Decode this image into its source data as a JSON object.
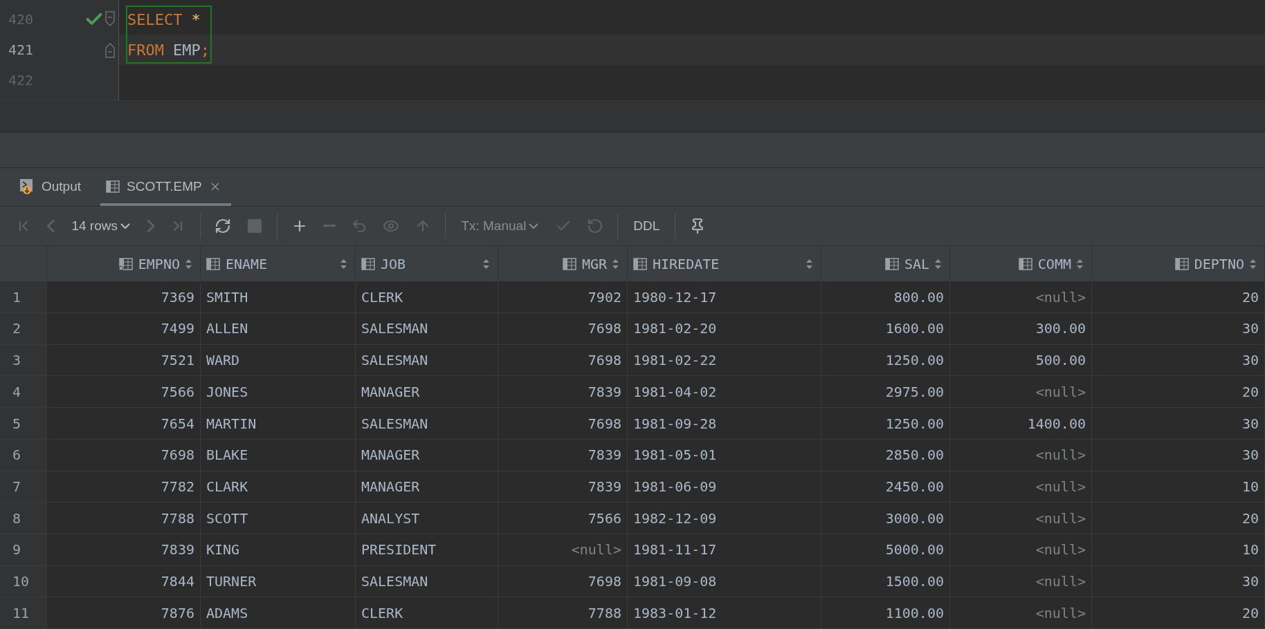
{
  "editor": {
    "lines": [
      {
        "number": "420",
        "current": false,
        "executed": true,
        "kind": "block-start",
        "tokens": [
          {
            "text": "SELECT",
            "kind": "keyword"
          },
          {
            "text": "*",
            "kind": "star"
          }
        ]
      },
      {
        "number": "421",
        "current": true,
        "executed": false,
        "kind": "block-end",
        "tokens": [
          {
            "text": "FROM",
            "kind": "keyword"
          },
          {
            "text": "EMP",
            "kind": "plain"
          },
          {
            "text": ";",
            "kind": "punct"
          }
        ]
      },
      {
        "number": "422",
        "current": false,
        "executed": false,
        "kind": "plain"
      }
    ]
  },
  "tabs": [
    {
      "label": "Output",
      "kind": "output",
      "selected": false,
      "closable": false
    },
    {
      "label": "SCOTT.EMP",
      "kind": "table",
      "selected": true,
      "closable": true
    }
  ],
  "toolbar": [
    {
      "kind": "first",
      "disabled": true
    },
    {
      "kind": "prev",
      "disabled": true
    },
    {
      "kind": "rows",
      "label": "14 rows",
      "disabled": false
    },
    {
      "kind": "next",
      "disabled": true
    },
    {
      "kind": "last",
      "disabled": true
    },
    {
      "kind": "sep"
    },
    {
      "kind": "refresh",
      "disabled": false
    },
    {
      "kind": "stop",
      "disabled": true
    },
    {
      "kind": "sep"
    },
    {
      "kind": "add",
      "disabled": false
    },
    {
      "kind": "remove",
      "disabled": true
    },
    {
      "kind": "revert",
      "disabled": true
    },
    {
      "kind": "view",
      "disabled": true
    },
    {
      "kind": "submit",
      "disabled": true
    },
    {
      "kind": "sep"
    },
    {
      "kind": "tx",
      "label": "Tx: Manual",
      "disabled": true
    },
    {
      "kind": "commit",
      "disabled": true
    },
    {
      "kind": "rollback",
      "disabled": true
    },
    {
      "kind": "sep"
    },
    {
      "kind": "ddl",
      "label": "DDL",
      "disabled": false
    },
    {
      "kind": "sep"
    },
    {
      "kind": "pin",
      "disabled": false
    }
  ],
  "table": {
    "columns": [
      {
        "name": "EMPNO",
        "kind": "number",
        "key": true
      },
      {
        "name": "ENAME",
        "kind": "text",
        "key": false
      },
      {
        "name": "JOB",
        "kind": "text",
        "key": false
      },
      {
        "name": "MGR",
        "kind": "number",
        "key": false
      },
      {
        "name": "HIREDATE",
        "kind": "text",
        "key": false
      },
      {
        "name": "SAL",
        "kind": "number",
        "key": false
      },
      {
        "name": "COMM",
        "kind": "number",
        "key": false
      },
      {
        "name": "DEPTNO",
        "kind": "number",
        "key": false
      }
    ],
    "rows": [
      {
        "number": "1",
        "cells": [
          "7369",
          "SMITH",
          "CLERK",
          "7902",
          "1980-12-17",
          "800.00",
          {
            "text": "<null>",
            "kind": "null"
          },
          "20"
        ]
      },
      {
        "number": "2",
        "cells": [
          "7499",
          "ALLEN",
          "SALESMAN",
          "7698",
          "1981-02-20",
          "1600.00",
          "300.00",
          "30"
        ]
      },
      {
        "number": "3",
        "cells": [
          "7521",
          "WARD",
          "SALESMAN",
          "7698",
          "1981-02-22",
          "1250.00",
          "500.00",
          "30"
        ]
      },
      {
        "number": "4",
        "cells": [
          "7566",
          "JONES",
          "MANAGER",
          "7839",
          "1981-04-02",
          "2975.00",
          {
            "text": "<null>",
            "kind": "null"
          },
          "20"
        ]
      },
      {
        "number": "5",
        "cells": [
          "7654",
          "MARTIN",
          "SALESMAN",
          "7698",
          "1981-09-28",
          "1250.00",
          "1400.00",
          "30"
        ]
      },
      {
        "number": "6",
        "cells": [
          "7698",
          "BLAKE",
          "MANAGER",
          "7839",
          "1981-05-01",
          "2850.00",
          {
            "text": "<null>",
            "kind": "null"
          },
          "30"
        ]
      },
      {
        "number": "7",
        "cells": [
          "7782",
          "CLARK",
          "MANAGER",
          "7839",
          "1981-06-09",
          "2450.00",
          {
            "text": "<null>",
            "kind": "null"
          },
          "10"
        ]
      },
      {
        "number": "8",
        "cells": [
          "7788",
          "SCOTT",
          "ANALYST",
          "7566",
          "1982-12-09",
          "3000.00",
          {
            "text": "<null>",
            "kind": "null"
          },
          "20"
        ]
      },
      {
        "number": "9",
        "cells": [
          "7839",
          "KING",
          "PRESIDENT",
          {
            "text": "<null>",
            "kind": "null"
          },
          "1981-11-17",
          "5000.00",
          {
            "text": "<null>",
            "kind": "null"
          },
          "10"
        ]
      },
      {
        "number": "10",
        "cells": [
          "7844",
          "TURNER",
          "SALESMAN",
          "7698",
          "1981-09-08",
          "1500.00",
          {
            "text": "<null>",
            "kind": "null"
          },
          "30"
        ]
      },
      {
        "number": "11",
        "cells": [
          "7876",
          "ADAMS",
          "CLERK",
          "7788",
          "1983-01-12",
          "1100.00",
          {
            "text": "<null>",
            "kind": "null"
          },
          "20"
        ]
      }
    ]
  }
}
